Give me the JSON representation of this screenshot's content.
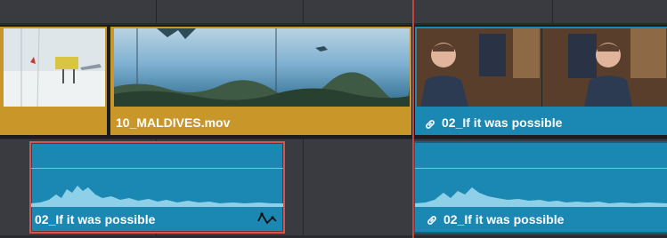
{
  "timeline": {
    "video_clips": [
      {
        "name": "",
        "color": "#c9962a"
      },
      {
        "name": "10_MALDIVES.mov",
        "color": "#c9962a"
      },
      {
        "name": "02_If it was possible",
        "color": "#1b88b3",
        "linked": true
      }
    ],
    "audio_clips": [
      {
        "name": "02_If it was possible",
        "color": "#1b88b3",
        "selected": true
      },
      {
        "name": "02_If it was possible",
        "color": "#1b88b3",
        "linked": true
      }
    ],
    "icons": {
      "link": "link-icon",
      "keyframe_curve": "keyframe-curve-icon"
    },
    "colors": {
      "playhead": "#c5433d",
      "selection": "#d9534f",
      "gold_clip": "#c9962a",
      "teal_clip": "#1b88b3"
    }
  }
}
